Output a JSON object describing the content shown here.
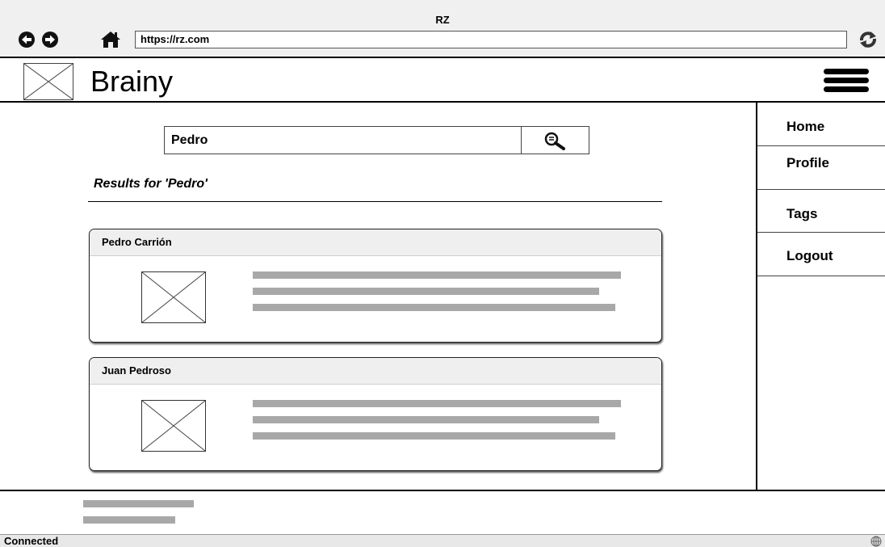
{
  "browser": {
    "title": "RZ",
    "url": "https://rz.com",
    "icons": [
      "back-icon",
      "forward-icon",
      "home-icon",
      "reload-icon"
    ]
  },
  "app": {
    "brand": "Brainy",
    "icons": [
      "logo-placeholder-icon",
      "hamburger-menu-icon"
    ]
  },
  "search": {
    "value": "Pedro",
    "icon": "magnifier-icon"
  },
  "results": {
    "heading": "Results for 'Pedro'",
    "items": [
      {
        "name": "Pedro Carrión"
      },
      {
        "name": "Juan Pedroso"
      }
    ]
  },
  "nav": {
    "items": [
      "Home",
      "Profile",
      "Tags",
      "Logout"
    ]
  },
  "status": {
    "text": "Connected",
    "icon": "globe-icon"
  },
  "colors": {
    "chrome_bg": "#f0f0f0",
    "card_header_bg": "#efefef",
    "placeholder_text_bar": "#a8a8a8"
  }
}
